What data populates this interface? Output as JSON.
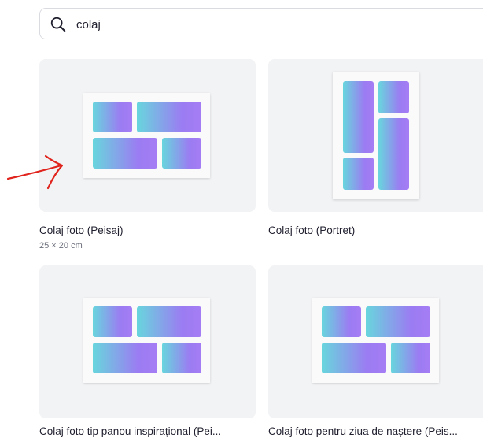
{
  "search": {
    "query": "colaj",
    "icon": "search-icon"
  },
  "results": [
    {
      "title": "Colaj foto (Peisaj)",
      "subtitle": "25 × 20 cm",
      "layout": "landscape"
    },
    {
      "title": "Colaj foto (Portret)",
      "layout": "portrait"
    },
    {
      "title": "Colaj foto tip panou inspirațional (Pei...",
      "layout": "landscape"
    },
    {
      "title": "Colaj foto pentru ziua de naștere (Peis...",
      "layout": "landscape"
    }
  ],
  "annotation": {
    "color": "#e0231c",
    "icon": "red-arrow-annotation"
  },
  "colors": {
    "thumb_bg": "#f2f3f5",
    "gradient_start": "#68d6dd",
    "gradient_end": "#a57df4"
  }
}
